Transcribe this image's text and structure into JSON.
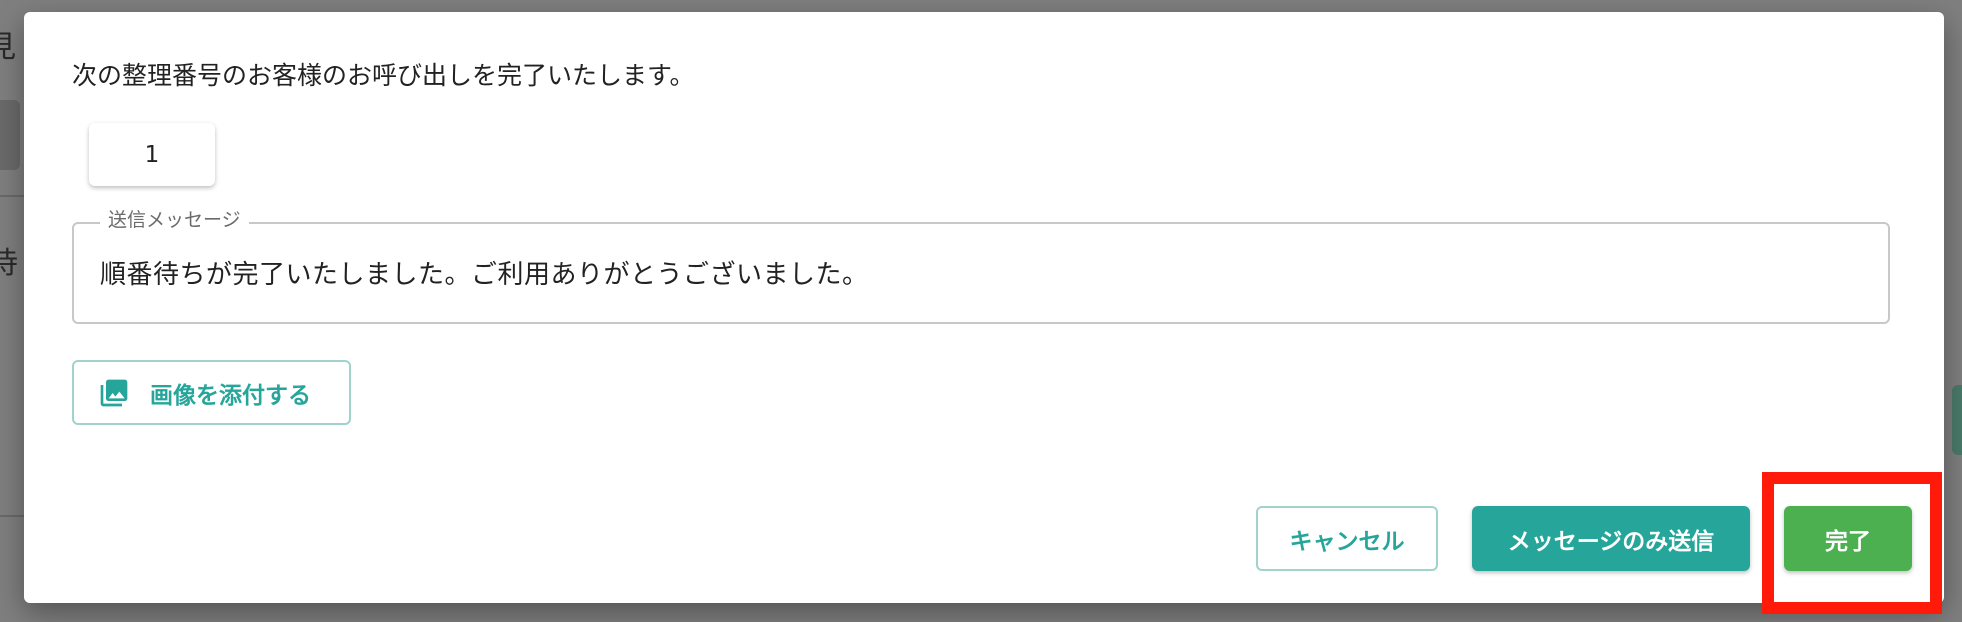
{
  "background": {
    "fragment_top": "見",
    "fragment_middle": "待"
  },
  "dialog": {
    "intro_text": "次の整理番号のお客様のお呼び出しを完了いたします。",
    "ticket_number": "1",
    "message": {
      "legend": "送信メッセージ",
      "value": "順番待ちが完了いたしました。ご利用ありがとうございました。"
    },
    "attach_image_label": "画像を添付する",
    "actions": {
      "cancel_label": "キャンセル",
      "send_message_only_label": "メッセージのみ送信",
      "complete_label": "完了"
    }
  },
  "colors": {
    "accent_teal": "#26a69a",
    "complete_green": "#4caf50",
    "highlight_red": "#ff1a0a"
  },
  "icons": {
    "attach": "image-gallery-icon"
  }
}
